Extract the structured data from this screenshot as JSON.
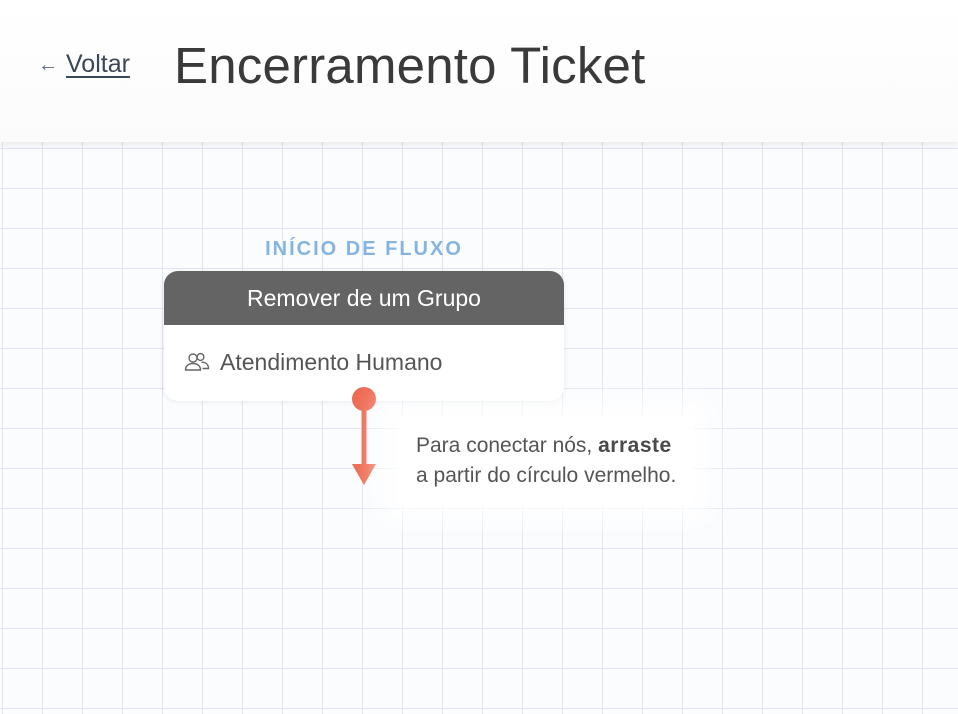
{
  "header": {
    "back_arrow": "←",
    "back_label": "Voltar",
    "title": "Encerramento Ticket"
  },
  "flow": {
    "start_label": "INÍCIO DE FLUXO",
    "node": {
      "title": "Remover de um Grupo",
      "icon": "users-icon",
      "group_name": "Atendimento Humano"
    },
    "hint": {
      "line1_prefix": "Para conectar nós,",
      "line1_bold": "arraste",
      "line2": "a partir do círculo vermelho."
    }
  },
  "colors": {
    "node_header": "#646464",
    "start_label": "#86b4e0",
    "connector": "#ee6a52",
    "grid_line": "#dfe6f0"
  }
}
